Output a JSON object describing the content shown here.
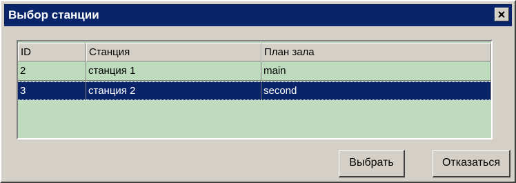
{
  "window": {
    "title": "Выбор станции"
  },
  "grid": {
    "columns": [
      "ID",
      "Станция",
      "План зала"
    ],
    "rows": [
      {
        "id": "2",
        "station": "станция 1",
        "plan": "main",
        "selected": false
      },
      {
        "id": "3",
        "station": "станция 2",
        "plan": "second",
        "selected": true
      }
    ]
  },
  "buttons": {
    "select_label": "Выбрать",
    "cancel_label": "Отказаться"
  },
  "colors": {
    "titlebar": "#0a246a",
    "grid_background": "#bfdbbe",
    "selection": "#0a246a",
    "face": "#d4d0c8"
  },
  "icons": {
    "close": "close-icon"
  }
}
